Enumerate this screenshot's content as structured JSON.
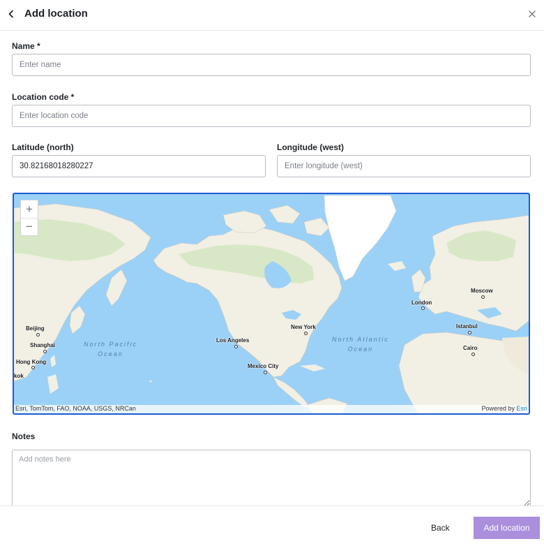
{
  "header": {
    "title": "Add location",
    "back_icon": "chevron-left-icon",
    "close_icon": "close-icon"
  },
  "form": {
    "name": {
      "label": "Name *",
      "placeholder": "Enter name",
      "value": ""
    },
    "location_code": {
      "label": "Location code *",
      "placeholder": "Enter location code",
      "value": ""
    },
    "latitude": {
      "label": "Latitude (north)",
      "placeholder": "Enter latitude (north)",
      "value": "30.82168018280227"
    },
    "longitude": {
      "label": "Longitude (west)",
      "placeholder": "Enter longitude (west)",
      "value": ""
    },
    "notes": {
      "label": "Notes",
      "placeholder": "Add notes here",
      "value": ""
    }
  },
  "map": {
    "zoom_in": "+",
    "zoom_out": "−",
    "attribution": "Esri, TomTom, FAO, NOAA, USGS, NRCan",
    "powered_by": "Powered by ",
    "powered_by_brand": "Esri",
    "cities": [
      "Moscow",
      "London",
      "Beijing",
      "New York",
      "Istanbul",
      "Shanghai",
      "Los Angeles",
      "Cairo",
      "Hong Kong",
      "Mexico City",
      "kok"
    ],
    "oceans": {
      "north_pacific": [
        "North Pacific",
        "Ocean"
      ],
      "north_atlantic": [
        "North Atlantic",
        "Ocean"
      ]
    },
    "colors": {
      "water": "#9bd1f7",
      "land": "#f2efe4",
      "vegetation": "#d8e8c6",
      "ice": "#ffffff",
      "selection_border": "#1b5bd6"
    }
  },
  "footer": {
    "back_label": "Back",
    "add_label": "Add location"
  },
  "colors": {
    "primary_button": "#ab8fdc",
    "border": "#b9bdc4"
  }
}
